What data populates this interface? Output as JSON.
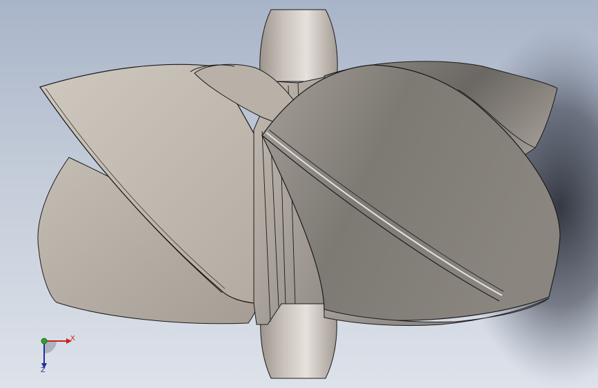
{
  "viewport": {
    "background_top": "#a8b4c8",
    "background_bottom": "#dde2ea"
  },
  "model": {
    "part": "propeller",
    "hub_color": "#c9c2bb",
    "blade_color_light": "#c7bfb6",
    "blade_color_dark": "#6d6a66",
    "edge_color": "#1a1a1a",
    "shadow_color": "#1a1e28"
  },
  "triad": {
    "x_label": "X",
    "z_label": "Z",
    "x_color": "#cc1f1f",
    "y_color": "#2aa32a",
    "z_color": "#1f2f99",
    "icon": "axis-triad-icon"
  }
}
